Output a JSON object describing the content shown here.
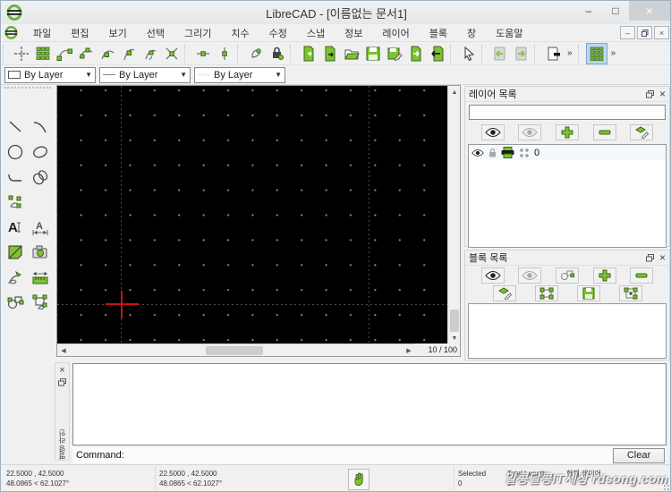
{
  "window": {
    "title": "LibreCAD - [이름없는 문서1]"
  },
  "menu": {
    "items": [
      "파일",
      "편집",
      "보기",
      "선택",
      "그리기",
      "치수",
      "수정",
      "스냅",
      "정보",
      "레이어",
      "블록",
      "창",
      "도움말"
    ]
  },
  "pen_toolbar": {
    "color_value": "By Layer",
    "linetype_value": "By Layer",
    "linewidth_value": "By Layer"
  },
  "canvas": {
    "page_indicator": "10 / 100"
  },
  "layer_list": {
    "title": "레이어 목록",
    "search_value": "",
    "rows": [
      {
        "name": "0"
      }
    ]
  },
  "block_list": {
    "title": "블록 목록"
  },
  "command_dock": {
    "title": "명령 라인",
    "prompt": "Command:",
    "clear_button": "Clear",
    "input_value": ""
  },
  "status_bar": {
    "absolute": {
      "coords": "22.5000 , 42.5000",
      "polar": "48.0865 < 62.1027°"
    },
    "relative": {
      "coords": "22.5000 , 42.5000",
      "polar": "48.0865 < 62.1027°"
    },
    "selected_label": "Selected",
    "selected_value": "0",
    "total_length_label": "Total Length",
    "total_length_value": "0",
    "current_layer_label": "현재 레이어"
  },
  "watermark": "알콩달콩IT세상 rdsong.com",
  "colors": {
    "accent_green": "#7dc32f",
    "crosshair_red": "#cc1111",
    "selection_blue": "#bcd8f0",
    "canvas_black": "#000000"
  },
  "icons": {
    "snap_toolbar": [
      "snap-free",
      "snap-grid",
      "snap-endpoint",
      "snap-on-entity",
      "snap-center",
      "snap-middle",
      "snap-distance",
      "snap-intersection",
      "restrict-horizontal",
      "restrict-vertical",
      "set-relative-zero",
      "lock-relative-zero"
    ],
    "file_toolbar": [
      "new-document",
      "new-from-template",
      "open-file",
      "save",
      "save-as",
      "export",
      "close-document"
    ],
    "edit_toolbar": [
      "selection-pointer",
      "undo",
      "redo",
      "print-preview",
      "overflow",
      "widget-options"
    ],
    "palette": [
      "line",
      "arc",
      "circle",
      "ellipse",
      "polyline",
      "spline",
      "points",
      "text",
      "dimension",
      "hatch",
      "image",
      "modify",
      "measure",
      "block",
      "explode"
    ],
    "layer_panel": [
      "show-all-layers",
      "hide-all-layers",
      "add-layer",
      "remove-layer",
      "edit-layer",
      "layer-visibility",
      "layer-lock",
      "layer-print",
      "layer-construction"
    ],
    "block_panel": [
      "show-all-blocks",
      "hide-all-blocks",
      "create-block",
      "add-block",
      "remove-block",
      "edit-block",
      "highlight-block",
      "save-block",
      "insert-block"
    ]
  }
}
